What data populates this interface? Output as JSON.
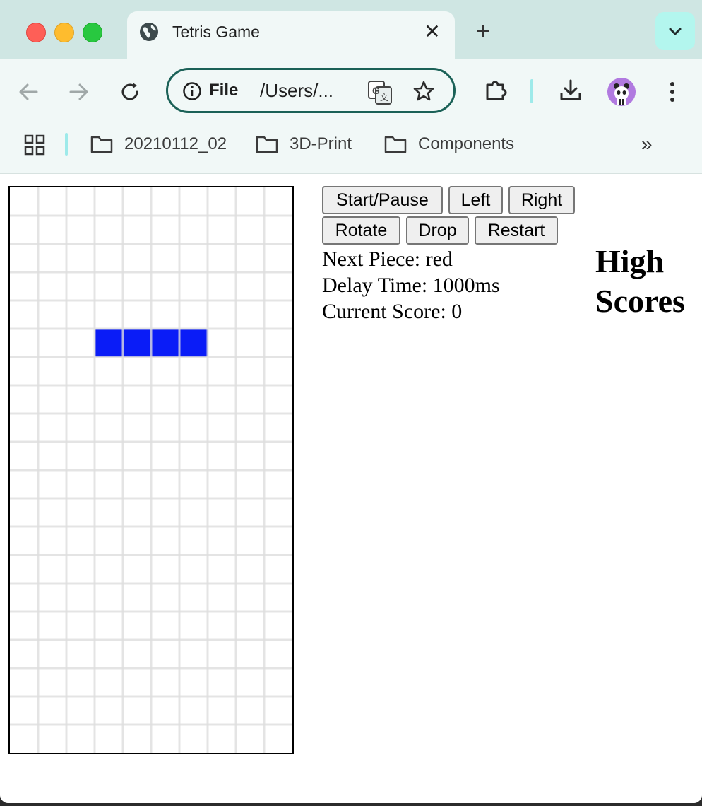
{
  "browser": {
    "tab_title": "Tetris Game",
    "tab_close": "✕",
    "new_tab": "+",
    "url_scheme": "File",
    "url_path": "/Users/...",
    "bookmarks": [
      {
        "label": "20210112_02"
      },
      {
        "label": "3D-Print"
      },
      {
        "label": "Components"
      }
    ],
    "bookmarks_more": "»"
  },
  "game": {
    "buttons": {
      "start_pause": "Start/Pause",
      "left": "Left",
      "right": "Right",
      "rotate": "Rotate",
      "drop": "Drop",
      "restart": "Restart"
    },
    "next_piece": "Next Piece: red",
    "delay_time": "Delay Time: 1000ms",
    "current_score": "Current Score: 0",
    "high_scores_title_line1": "High",
    "high_scores_title_line2": "Scores",
    "board": {
      "columns": 10,
      "rows": 20,
      "grid_color": "#dddddd",
      "active_piece": {
        "color": "#0a1cf7",
        "cells": [
          [
            3,
            5
          ],
          [
            4,
            5
          ],
          [
            5,
            5
          ],
          [
            6,
            5
          ]
        ]
      }
    }
  }
}
